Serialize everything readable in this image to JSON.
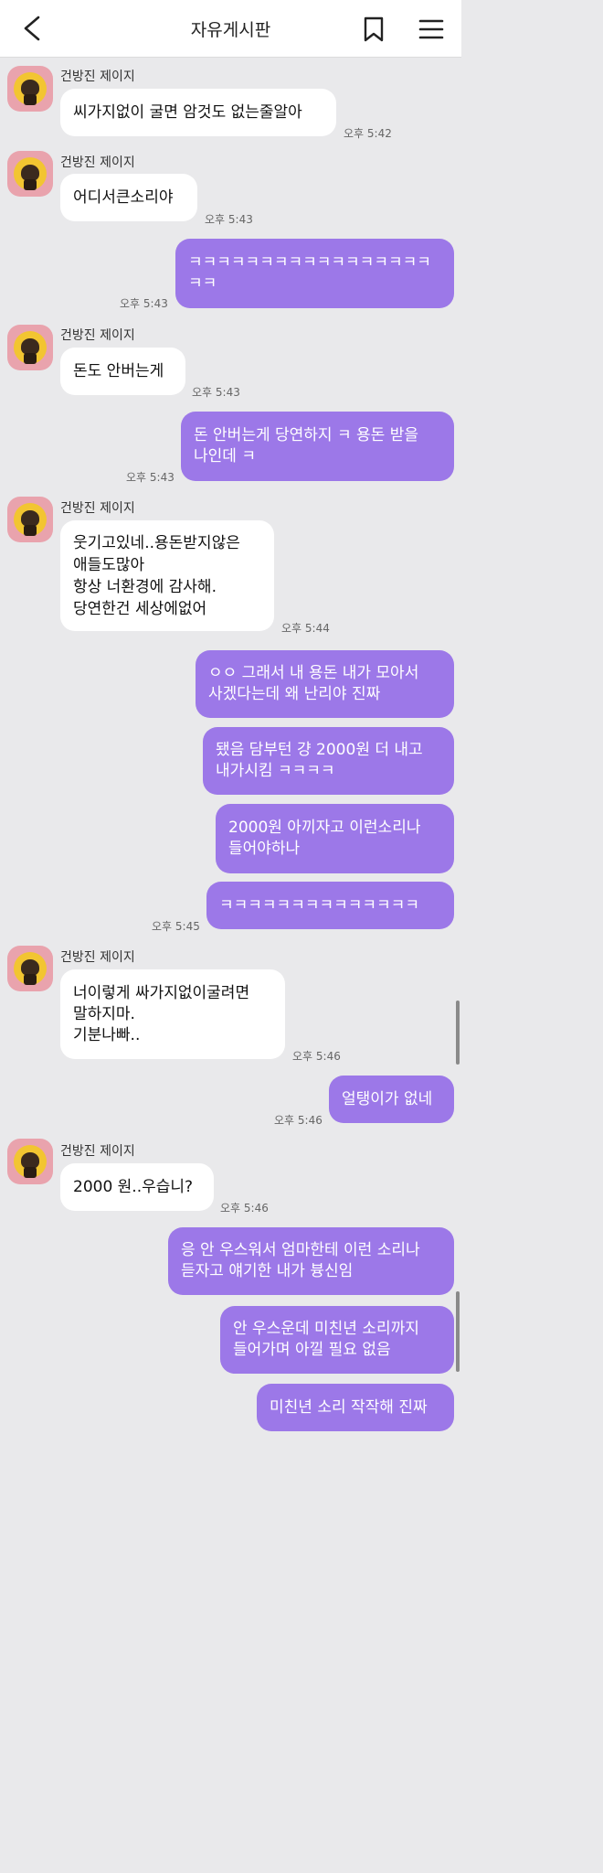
{
  "header": {
    "title": "자유게시판",
    "icons": [
      "back-icon",
      "bookmark-icon",
      "menu-icon"
    ]
  },
  "contact_name": "건방진 제이지",
  "colors": {
    "sent_bubble": "#9c78e8",
    "received_bubble": "#ffffff",
    "background": "#e9e9eb",
    "avatar_bg": "#e9a3ad"
  },
  "messages": [
    {
      "from": "other",
      "text": "씨가지없이 굴면 암것도 없는줄알아",
      "time": "오후 5:42"
    },
    {
      "from": "other",
      "text": "어디서큰소리야",
      "time": "오후 5:43"
    },
    {
      "from": "me",
      "text": "ㅋㅋㅋㅋㅋㅋㅋㅋㅋㅋㅋㅋㅋㅋㅋㅋㅋ\nㅋㅋ",
      "time": "오후 5:43"
    },
    {
      "from": "other",
      "text": "돈도 안버는게",
      "time": "오후 5:43"
    },
    {
      "from": "me",
      "text": "돈 안버는게 당연하지 ㅋ 용돈 받을\n나인데 ㅋ",
      "time": "오후 5:43"
    },
    {
      "from": "other",
      "text": "웃기고있네..용돈받지않은\n애들도많아\n항상 너환경에 감사해.\n당연한건 세상에없어",
      "time": "오후 5:44"
    },
    {
      "from": "me",
      "text": "ㅇㅇ 그래서 내 용돈 내가 모아서\n사겠다는데 왜 난리야 진짜",
      "time": ""
    },
    {
      "from": "me",
      "text": "됐음 담부턴 걍 2000원 더 내고\n내가시킴 ㅋㅋㅋㅋ",
      "time": ""
    },
    {
      "from": "me",
      "text": "2000원 아끼자고 이런소리나\n들어야하나",
      "time": ""
    },
    {
      "from": "me",
      "text": "ㅋㅋㅋㅋㅋㅋㅋㅋㅋㅋㅋㅋㅋㅋ",
      "time": "오후 5:45"
    },
    {
      "from": "other",
      "text": "너이렇게 싸가지없이굴려면\n말하지마.\n기분나빠..",
      "time": "오후 5:46"
    },
    {
      "from": "me",
      "text": "얼탱이가 없네",
      "time": "오후 5:46"
    },
    {
      "from": "other",
      "text": "2000 원..우습니?",
      "time": "오후 5:46"
    },
    {
      "from": "me",
      "text": "응 안 우스워서 엄마한테 이런 소리나\n듣자고 얘기한 내가 븅신임",
      "time": ""
    },
    {
      "from": "me",
      "text": "안 우스운데 미친년 소리까지\n들어가며 아낄 필요 없음",
      "time": ""
    },
    {
      "from": "me",
      "text": "미친년 소리 작작해 진짜",
      "time": ""
    }
  ]
}
